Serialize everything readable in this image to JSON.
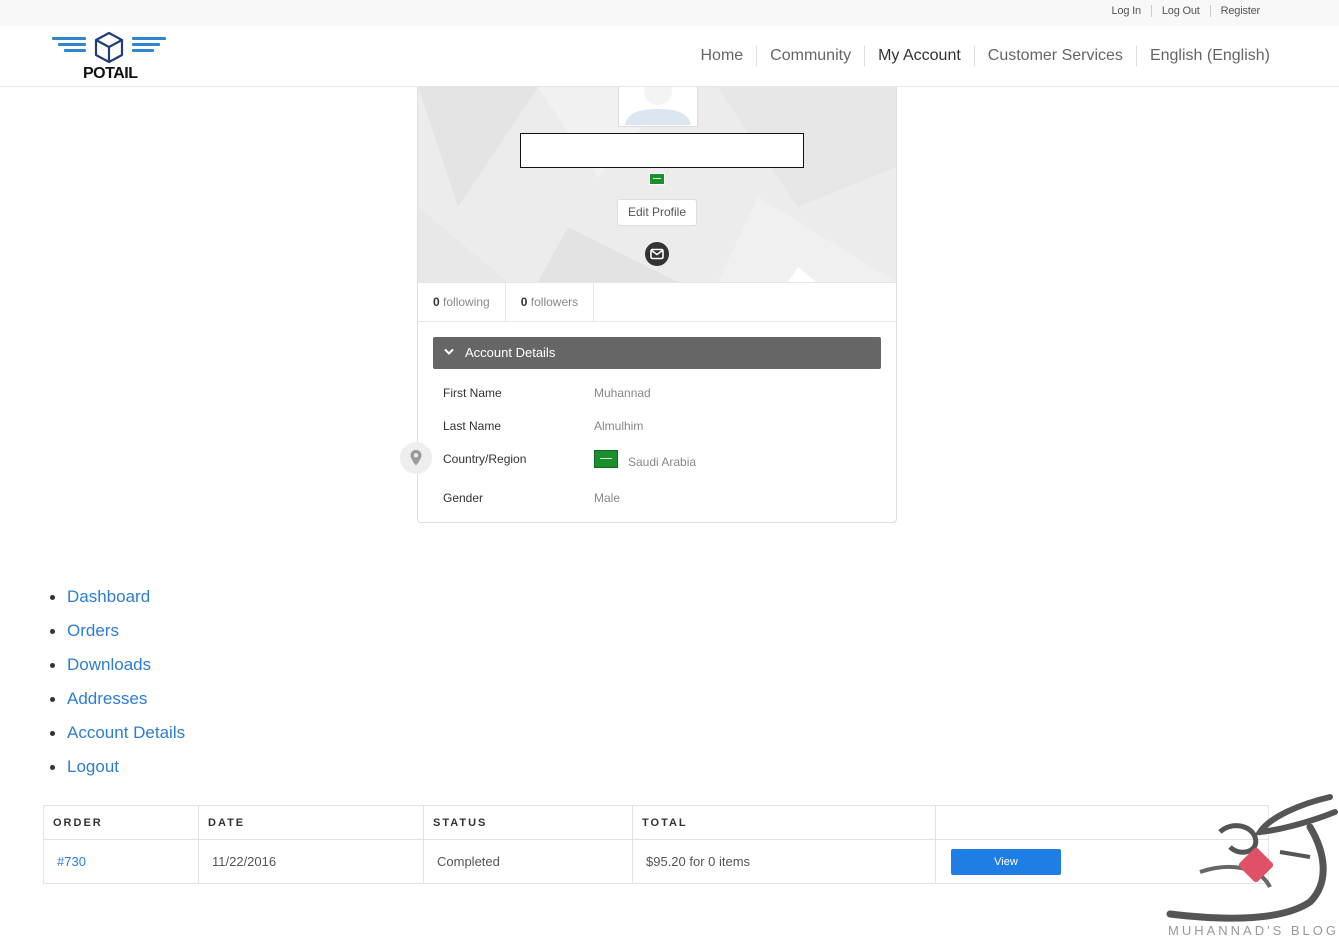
{
  "topbar": {
    "links": [
      "Log In",
      "Log Out",
      "Register"
    ]
  },
  "header": {
    "logo_text": "POTAIL",
    "nav": [
      {
        "label": "Home",
        "active": false
      },
      {
        "label": "Community",
        "active": false
      },
      {
        "label": "My Account",
        "active": true
      },
      {
        "label": "Customer Services",
        "active": false
      },
      {
        "label": "English (English)",
        "active": false
      }
    ]
  },
  "profile": {
    "edit_label": "Edit Profile",
    "following_count": "0",
    "following_label": "following",
    "followers_count": "0",
    "followers_label": "followers",
    "section_title": "Account Details",
    "fields": [
      {
        "label": "First Name",
        "value": "Muhannad"
      },
      {
        "label": "Last Name",
        "value": "Almulhim"
      },
      {
        "label": "Country/Region",
        "value": "Saudi Arabia"
      },
      {
        "label": "Gender",
        "value": "Male"
      }
    ],
    "flag_color": "#1a8f2c"
  },
  "account_nav": [
    "Dashboard",
    "Orders",
    "Downloads",
    "Addresses",
    "Account Details",
    "Logout"
  ],
  "orders": {
    "headers": [
      "ORDER",
      "DATE",
      "STATUS",
      "TOTAL",
      ""
    ],
    "rows": [
      {
        "order": "#730",
        "date": "11/22/2016",
        "status": "Completed",
        "total": "$95.20 for 0 items",
        "action": "View"
      }
    ]
  },
  "watermark": {
    "text": "MUHANNAD'S BLOG"
  },
  "colors": {
    "link": "#2d7dd2",
    "button": "#1e7ee5",
    "accordion": "#666666"
  }
}
